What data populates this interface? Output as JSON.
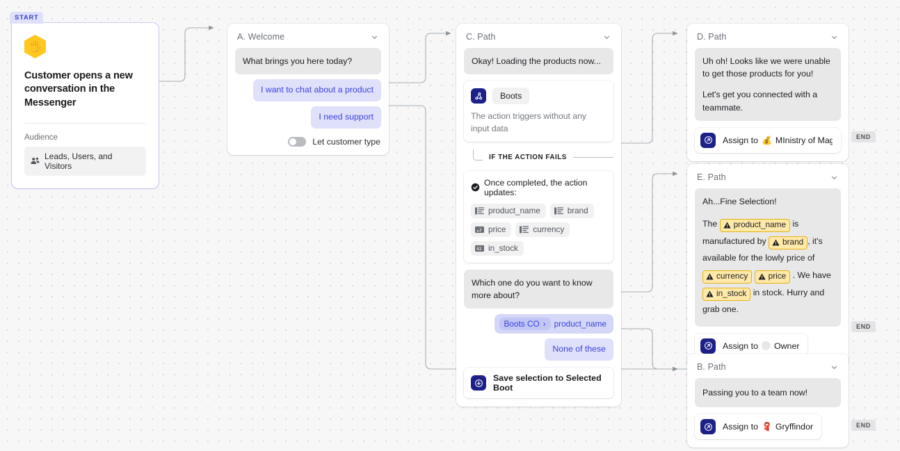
{
  "canvas": {
    "start_badge": "START",
    "end_badge": "END"
  },
  "start_card": {
    "emoji": "🖐",
    "title": "Customer opens a new conversation in the Messenger",
    "audience_label": "Audience",
    "audience_value": "Leads, Users, and Visitors",
    "audience_icon": "people-icon"
  },
  "welcome_card": {
    "title": "A. Welcome",
    "message": "What brings you here today?",
    "replies": [
      "I want to chat about a product",
      "I need support"
    ],
    "toggle_label": "Let customer type",
    "toggle_on": false
  },
  "path_c": {
    "title": "C. Path",
    "message": "Okay! Loading the products now...",
    "action": {
      "app_icon": "workflow-icon",
      "app_name": "Boots",
      "note": "The action triggers without any input data"
    },
    "fail_label": "IF THE ACTION FAILS",
    "updates_label": "Once completed, the action updates:",
    "updates_icon": "check-circle-icon",
    "attributes": [
      {
        "name": "product_name",
        "type": "text"
      },
      {
        "name": "brand",
        "type": "text"
      },
      {
        "name": "price",
        "type": "decimal"
      },
      {
        "name": "currency",
        "type": "text"
      },
      {
        "name": "in_stock",
        "type": "number"
      }
    ],
    "question": "Which one do you want to know more about?",
    "selector": {
      "source": "Boots CO",
      "separator": "›",
      "field": "product_name"
    },
    "none_reply": "None of these",
    "save": {
      "icon": "save-circle-icon",
      "label": "Save selection to Selected Boot"
    }
  },
  "path_d": {
    "title": "D. Path",
    "message_lines": [
      "Uh oh! Looks like we were unable to get those products for you!",
      "Let's get you connected with a teammate."
    ],
    "assign": {
      "icon": "assign-icon",
      "prefix": "Assign to",
      "emoji": "💰",
      "target": "MInistry of Magic Le..."
    }
  },
  "path_e": {
    "title": "E. Path",
    "line1": "Ah...Fine Selection!",
    "segments": [
      {
        "t": "text",
        "v": "The "
      },
      {
        "t": "token",
        "v": "product_name"
      },
      {
        "t": "text",
        "v": " is manufactured by "
      },
      {
        "t": "token",
        "v": "brand"
      },
      {
        "t": "text",
        "v": ", it's available for the lowly price of "
      },
      {
        "t": "token",
        "v": "currency"
      },
      {
        "t": "text",
        "v": " "
      },
      {
        "t": "token",
        "v": "price"
      },
      {
        "t": "text",
        "v": " . We have "
      },
      {
        "t": "token",
        "v": "in_stock"
      },
      {
        "t": "text",
        "v": " in stock. Hurry and grab one."
      }
    ],
    "assign": {
      "icon": "assign-icon",
      "prefix": "Assign to",
      "avatar": "owner-avatar",
      "target": "Owner"
    }
  },
  "path_b": {
    "title": "B. Path",
    "message": "Passing you to a team now!",
    "assign": {
      "icon": "assign-icon",
      "prefix": "Assign to",
      "emoji": "🧣",
      "target": "Gryffindor"
    }
  },
  "colors": {
    "accent": "#3b41de",
    "reply_bg": "#dfe1fb",
    "bubble_bg": "#e8e8e9",
    "app_icon_bg": "#1d2187",
    "token_bg": "#ffe9a8",
    "token_border": "#e8b10f",
    "hex_yellow": "#ffc720",
    "wire": "#9aa0a6"
  }
}
